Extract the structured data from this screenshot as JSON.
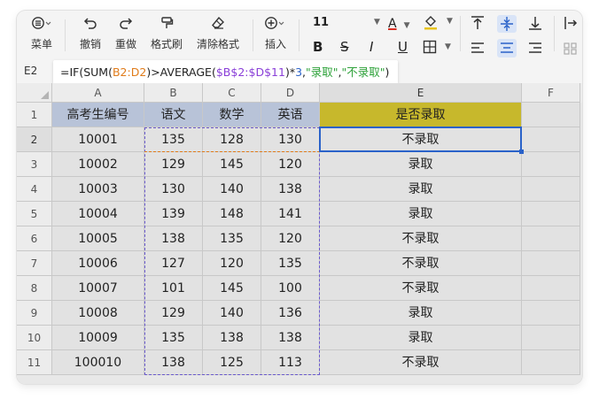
{
  "toolbar": {
    "menu_label": "菜单",
    "undo_label": "撤销",
    "redo_label": "重做",
    "format_painter_label": "格式刷",
    "clear_format_label": "清除格式",
    "insert_label": "插入",
    "font_size": "11",
    "bold_glyph": "B",
    "strike_glyph": "S",
    "italic_glyph": "I",
    "underline_glyph": "U",
    "font_color_glyph": "A",
    "accent_red": "#d93025"
  },
  "formula_bar": {
    "cell_ref": "E2",
    "parts": {
      "p1": "=IF(SUM(",
      "p2": "B2:D2",
      "p3": ")>AVERAGE(",
      "p4": "$B$2:$D$11",
      "p5": ")*",
      "p6": "3",
      "p7": ",",
      "p8": "\"录取\"",
      "p9": ",",
      "p10": "\"不录取\"",
      "p11": ")"
    }
  },
  "sheet": {
    "columns": [
      "A",
      "B",
      "C",
      "D",
      "E",
      "F"
    ],
    "header_row": {
      "row_num": "1",
      "cells": [
        "高考生编号",
        "语文",
        "数学",
        "英语",
        "是否录取",
        ""
      ]
    },
    "rows": [
      {
        "row_num": "2",
        "cells": [
          "10001",
          "135",
          "128",
          "130",
          "不录取",
          ""
        ]
      },
      {
        "row_num": "3",
        "cells": [
          "10002",
          "129",
          "145",
          "120",
          "录取",
          ""
        ]
      },
      {
        "row_num": "4",
        "cells": [
          "10003",
          "130",
          "140",
          "138",
          "录取",
          ""
        ]
      },
      {
        "row_num": "5",
        "cells": [
          "10004",
          "139",
          "148",
          "141",
          "录取",
          ""
        ]
      },
      {
        "row_num": "6",
        "cells": [
          "10005",
          "138",
          "135",
          "120",
          "不录取",
          ""
        ]
      },
      {
        "row_num": "7",
        "cells": [
          "10006",
          "127",
          "120",
          "135",
          "不录取",
          ""
        ]
      },
      {
        "row_num": "8",
        "cells": [
          "10007",
          "101",
          "145",
          "100",
          "不录取",
          ""
        ]
      },
      {
        "row_num": "9",
        "cells": [
          "10008",
          "129",
          "140",
          "136",
          "录取",
          ""
        ]
      },
      {
        "row_num": "10",
        "cells": [
          "10009",
          "135",
          "138",
          "138",
          "录取",
          ""
        ]
      },
      {
        "row_num": "11",
        "cells": [
          "100010",
          "138",
          "125",
          "113",
          "不录取",
          ""
        ]
      }
    ],
    "selected_cell": "E2",
    "colors": {
      "header_fill": "#b8c3d8",
      "result_header_fill": "#c7b82c",
      "selection": "#2a62c9",
      "range_total": "#6a5acd",
      "range_row": "#e07b1a"
    }
  }
}
